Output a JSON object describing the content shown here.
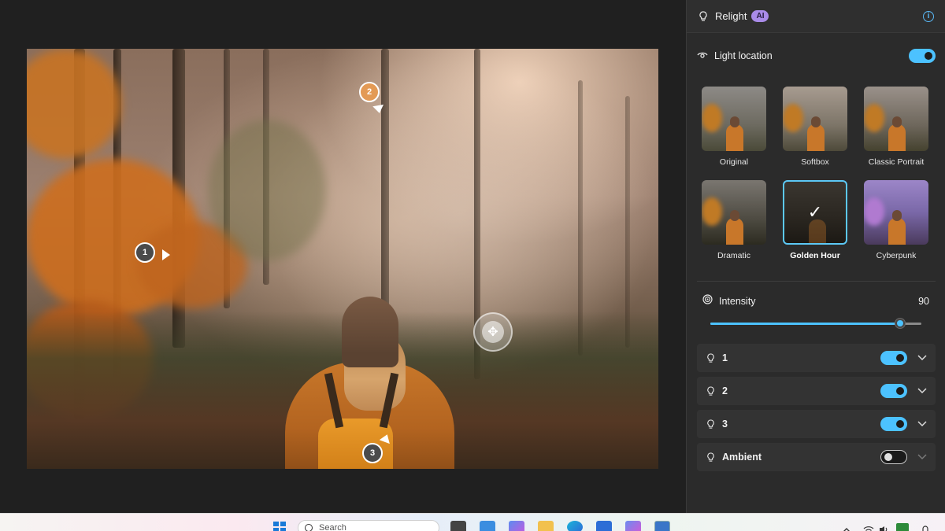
{
  "panel": {
    "title": "Relight",
    "badge": "AI",
    "light_location_label": "Light location",
    "presets": [
      {
        "label": "Original",
        "selected": false
      },
      {
        "label": "Softbox",
        "selected": false
      },
      {
        "label": "Classic Portrait",
        "selected": false
      },
      {
        "label": "Dramatic",
        "selected": false
      },
      {
        "label": "Golden Hour",
        "selected": true
      },
      {
        "label": "Cyberpunk",
        "selected": false
      }
    ],
    "intensity_label": "Intensity",
    "intensity_value": "90",
    "intensity_fraction": 0.9,
    "lights": [
      {
        "label": "1",
        "on": true
      },
      {
        "label": "2",
        "on": true
      },
      {
        "label": "3",
        "on": true
      },
      {
        "label": "Ambient",
        "on": false
      }
    ]
  },
  "canvas": {
    "markers": [
      "1",
      "2",
      "3"
    ]
  },
  "taskbar": {
    "search_placeholder": "Search"
  },
  "colors": {
    "accent": "#4cc2ff",
    "ai_badge": "#a98be8",
    "panel_bg": "#2b2b2b",
    "app_bg": "#202020"
  }
}
